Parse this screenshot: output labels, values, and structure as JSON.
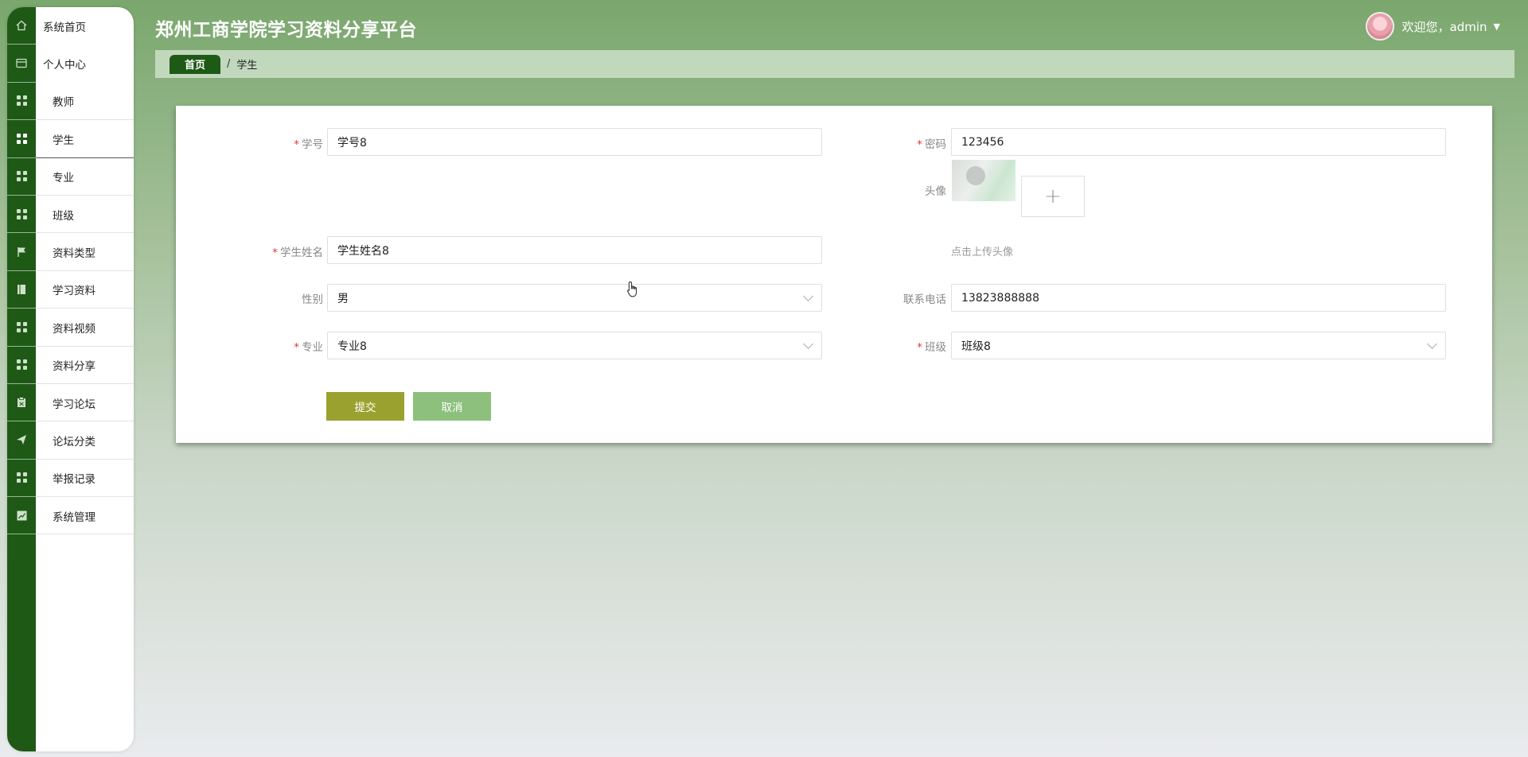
{
  "app": {
    "title": "郑州工商学院学习资料分享平台"
  },
  "header": {
    "greeting": "欢迎您，admin",
    "caret": "▼"
  },
  "sidebar": {
    "items": [
      {
        "label": "系统首页",
        "icon": "home-icon"
      },
      {
        "label": "个人中心",
        "icon": "wallet-icon"
      },
      {
        "label": "教师",
        "icon": "grid-icon"
      },
      {
        "label": "学生",
        "icon": "grid-icon",
        "active": true
      },
      {
        "label": "专业",
        "icon": "grid-icon"
      },
      {
        "label": "班级",
        "icon": "grid-icon"
      },
      {
        "label": "资料类型",
        "icon": "flag-icon"
      },
      {
        "label": "学习资料",
        "icon": "book-icon"
      },
      {
        "label": "资料视频",
        "icon": "grid-icon"
      },
      {
        "label": "资料分享",
        "icon": "grid-icon"
      },
      {
        "label": "学习论坛",
        "icon": "clipboard-icon"
      },
      {
        "label": "论坛分类",
        "icon": "send-icon"
      },
      {
        "label": "举报记录",
        "icon": "grid-icon"
      },
      {
        "label": "系统管理",
        "icon": "chart-icon"
      }
    ]
  },
  "breadcrumb": {
    "home": "首页",
    "separator": "/",
    "current": "学生"
  },
  "form": {
    "required_mark": "*",
    "student_no": {
      "label": "学号",
      "value": "学号8"
    },
    "password": {
      "label": "密码",
      "value": "123456"
    },
    "avatar": {
      "label": "头像",
      "upload_symbol": "+",
      "hint": "点击上传头像"
    },
    "student_name": {
      "label": "学生姓名",
      "value": "学生姓名8"
    },
    "gender": {
      "label": "性别",
      "value": "男"
    },
    "phone": {
      "label": "联系电话",
      "value": "13823888888"
    },
    "major": {
      "label": "专业",
      "value": "专业8"
    },
    "class": {
      "label": "班级",
      "value": "班级8"
    },
    "submit_label": "提交",
    "cancel_label": "取消"
  },
  "colors": {
    "sidebar_rail": "#1e5a16",
    "breadcrumb_bg": "#c2d8bd",
    "submit_button": "#9ba12f",
    "cancel_button": "#8dc07c",
    "required": "#e0363e"
  }
}
